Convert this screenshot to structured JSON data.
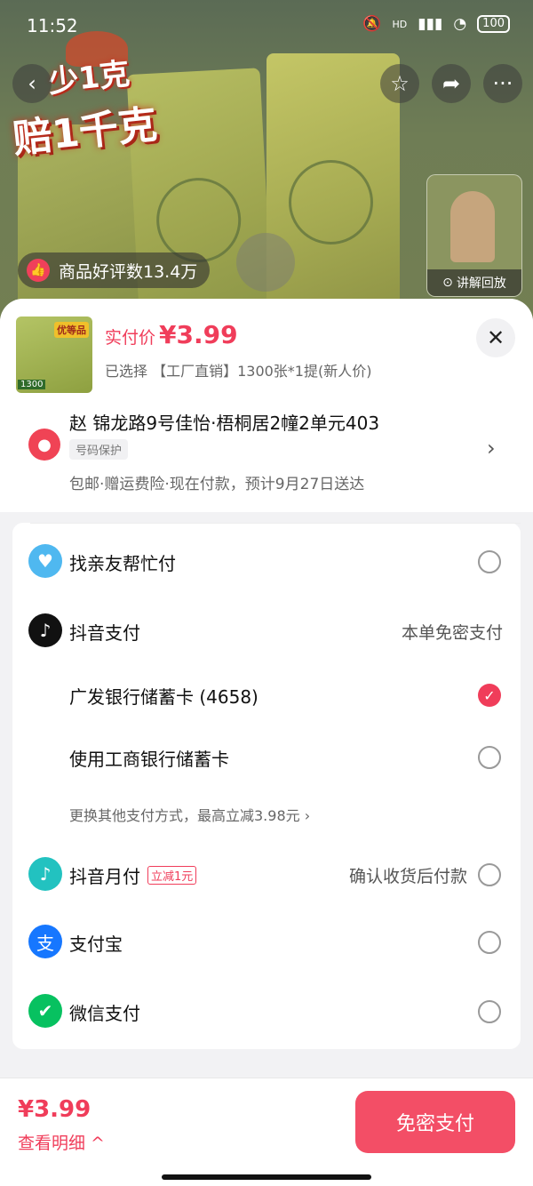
{
  "status_bar": {
    "time": "11:52",
    "network": "HD",
    "battery": "100"
  },
  "hero": {
    "promo_line1": "少1克",
    "promo_line2": "赔1千克",
    "review_chip": "商品好评数13.4万",
    "video_caption": "讲解回放"
  },
  "product": {
    "price_label": "实付价",
    "price": "¥3.99",
    "selected_text": "已选择 【工厂直销】1300张*1提(新人价)",
    "thumb_tag": "优等品",
    "thumb_num": "1300"
  },
  "address": {
    "line": "赵  锦龙路9号佳怡·梧桐居2幢2单元403",
    "tag": "号码保护",
    "shipping": "包邮·赠运费险·现在付款，预计9月27日送达"
  },
  "payment": {
    "friend_pay": "找亲友帮忙付",
    "douyin_pay": "抖音支付",
    "douyin_pay_note": "本单免密支付",
    "card1": "广发银行储蓄卡 (4658)",
    "card2": "使用工商银行储蓄卡",
    "more_methods": "更换其他支付方式，最高立减3.98元 ",
    "monthly_pay": "抖音月付",
    "monthly_discount": "立减1元",
    "monthly_note": "确认收货后付款",
    "alipay": "支付宝",
    "wechat": "微信支付"
  },
  "bottom": {
    "price": "¥3.99",
    "detail": "查看明细 ^",
    "button": "免密支付"
  },
  "colors": {
    "accent": "#f03d5a",
    "button": "#f34e66"
  }
}
